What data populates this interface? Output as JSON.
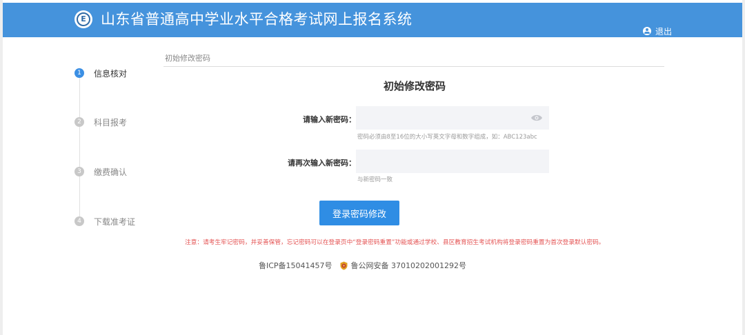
{
  "header": {
    "title": "山东省普通高中学业水平合格考试网上报名系统",
    "logo_letter": "E",
    "logout_label": "退出",
    "background_color": "#4593dc"
  },
  "steps": [
    {
      "number": "1",
      "label": "信息核对",
      "active": true
    },
    {
      "number": "2",
      "label": "科目报考",
      "active": false
    },
    {
      "number": "3",
      "label": "缴费确认",
      "active": false
    },
    {
      "number": "4",
      "label": "下载准考证",
      "active": false
    }
  ],
  "breadcrumb": "初始修改密码",
  "form": {
    "title": "初始修改密码",
    "new_password_label": "请输入新密码：",
    "new_password_value": "",
    "new_password_hint": "密码必须由8至16位的大小写英文字母和数字组成，如：ABC123abc",
    "confirm_password_label": "请再次输入新密码：",
    "confirm_password_value": "",
    "confirm_password_hint": "与新密码一致",
    "submit_label": "登录密码修改",
    "accent_color": "#2f8de4"
  },
  "notice": "注意：请考生牢记密码，并妥善保管，忘记密码可以在登录页中“登录密码重置”功能或通过学校、县区教育招生考试机构将登录密码重置为首次登录默认密码。",
  "footer": {
    "icp": "鲁ICP备15041457号",
    "police": "鲁公网安备 37010202001292号"
  },
  "icons": {
    "logo": "logo-icon",
    "logout": "user-icon",
    "password_toggle": "eye-icon",
    "police_badge": "police-badge-icon"
  }
}
